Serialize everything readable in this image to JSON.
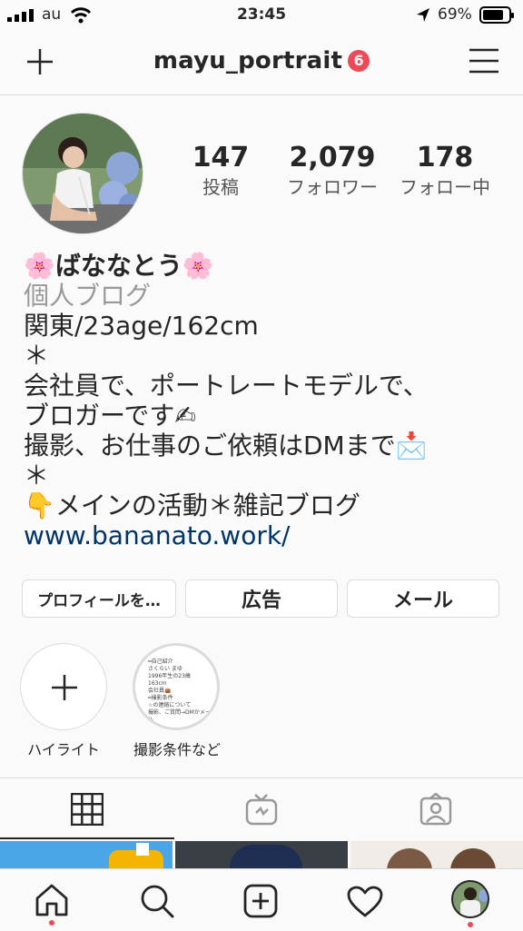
{
  "status_bar": {
    "carrier": "au",
    "time": "23:45",
    "battery_percent": "69%"
  },
  "header": {
    "username": "mayu_portrait",
    "notification_count": "6"
  },
  "profile": {
    "stats": [
      {
        "value": "147",
        "label": "投稿"
      },
      {
        "value": "2,079",
        "label": "フォロワー"
      },
      {
        "value": "178",
        "label": "フォロー中"
      }
    ],
    "bio": {
      "name_flower": "🌸",
      "name": "ばななとう",
      "category": "個人ブログ",
      "line1": "関東/23age/162cm",
      "line2": "＊",
      "line3": "会社員で、ポートレートモデルで、",
      "line4": "ブロガーです✍",
      "line5": "撮影、お仕事のご依頼はDMまで📩",
      "line6": "＊",
      "line7": "👇メインの活動＊雑記ブログ",
      "link": "www.bananato.work/"
    },
    "buttons": {
      "edit_profile": "プロフィールを…",
      "ads": "広告",
      "email": "メール"
    }
  },
  "highlights": [
    {
      "label": "ハイライト"
    },
    {
      "label": "撮影条件など",
      "cover_text": [
        "━自己紹介",
        "さくらい まゆ",
        "1996年生の23歳",
        "163cm",
        "会社員👜",
        "━撮影条件",
        "☆の連絡について",
        "撮影、ご質問→DMかメール"
      ]
    }
  ],
  "colors": {
    "accent_red": "#ed4956",
    "link_blue": "#003569",
    "border": "#dbdbdb"
  }
}
